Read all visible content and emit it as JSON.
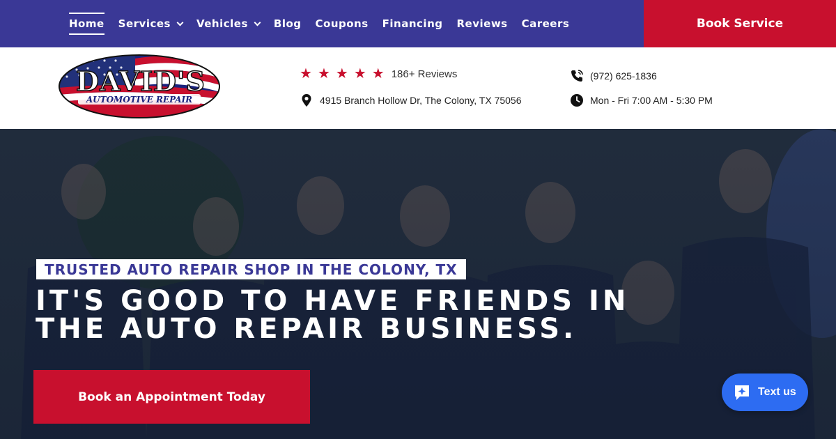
{
  "nav": {
    "items": [
      {
        "label": "Home",
        "active": true,
        "dropdown": false
      },
      {
        "label": "Services",
        "active": false,
        "dropdown": true
      },
      {
        "label": "Vehicles",
        "active": false,
        "dropdown": true
      },
      {
        "label": "Blog",
        "active": false,
        "dropdown": false
      },
      {
        "label": "Coupons",
        "active": false,
        "dropdown": false
      },
      {
        "label": "Financing",
        "active": false,
        "dropdown": false
      },
      {
        "label": "Reviews",
        "active": false,
        "dropdown": false
      },
      {
        "label": "Careers",
        "active": false,
        "dropdown": false
      }
    ],
    "book_service": "Book Service"
  },
  "logo": {
    "line1": "DAVID'S",
    "line2": "AUTOMOTIVE REPAIR"
  },
  "info": {
    "rating_stars": 5,
    "reviews": "186+ Reviews",
    "address": "4915 Branch Hollow Dr, The Colony, TX 75056",
    "phone": "(972) 625-1836",
    "hours": "Mon - Fri 7:00 AM - 5:30 PM"
  },
  "hero": {
    "tagline": "TRUSTED AUTO REPAIR SHOP IN THE COLONY, TX",
    "headline_line1": "IT'S GOOD TO HAVE FRIENDS IN",
    "headline_line2": "THE AUTO REPAIR BUSINESS.",
    "cta": "Book an Appointment Today"
  },
  "chat": {
    "label": "Text us"
  },
  "colors": {
    "nav_bg": "#3a3896",
    "accent": "#c8102e",
    "chat": "#2d6cf2"
  }
}
